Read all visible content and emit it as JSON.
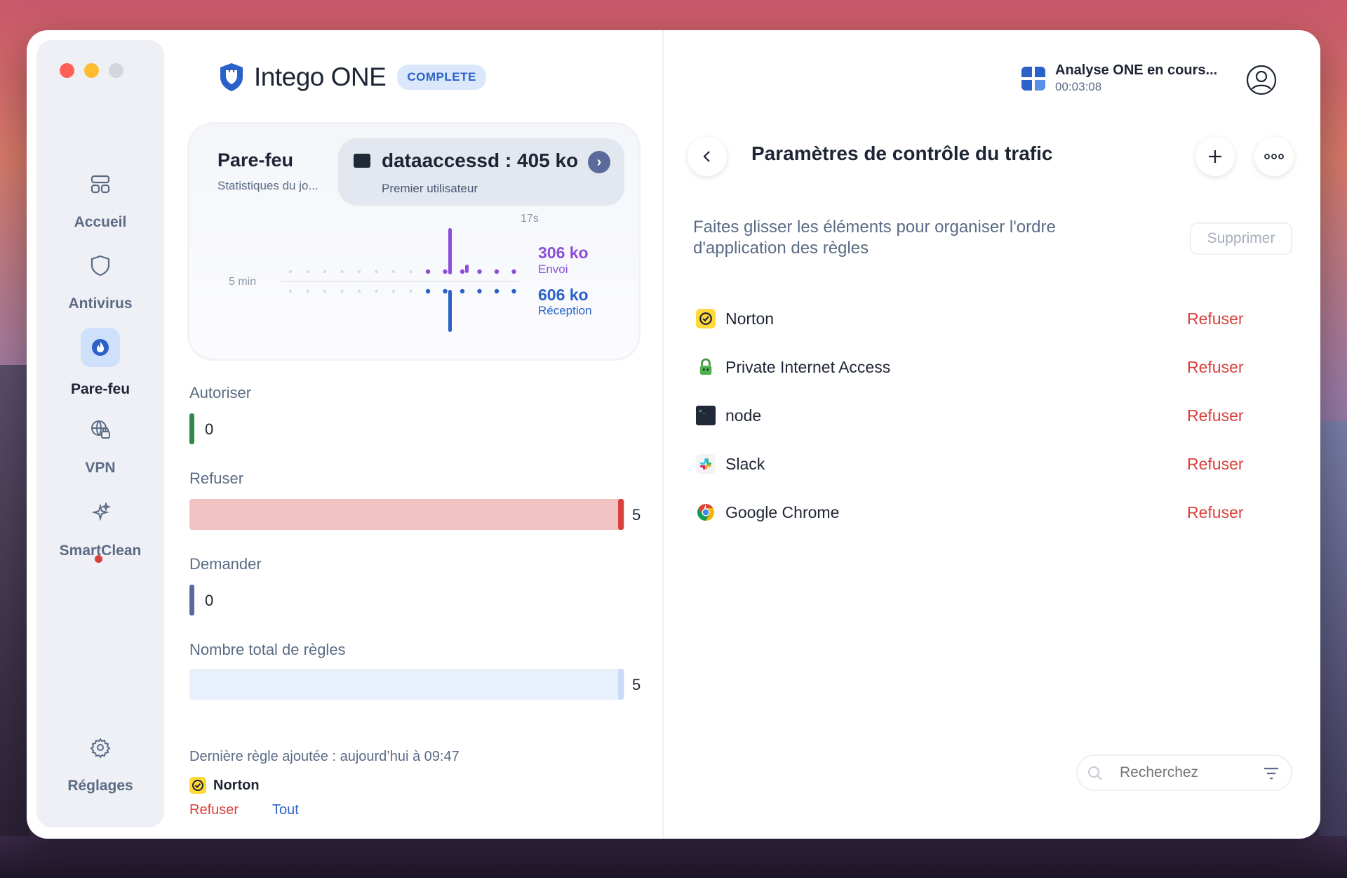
{
  "app": {
    "name": "Intego ONE",
    "badge": "COMPLETE"
  },
  "sidebar": {
    "items": [
      {
        "label": "Accueil",
        "icon": "home-grid-icon"
      },
      {
        "label": "Antivirus",
        "icon": "antivirus-shield-icon"
      },
      {
        "label": "Pare-feu",
        "icon": "firewall-flame-icon",
        "active": true
      },
      {
        "label": "VPN",
        "icon": "vpn-globe-icon"
      },
      {
        "label": "SmartClean",
        "icon": "smartclean-sparkle-icon",
        "notification": true
      },
      {
        "label": "Réglages",
        "icon": "gear-icon"
      }
    ]
  },
  "firewall_card": {
    "title": "Pare-feu",
    "subtitle": "Statistiques du jo...",
    "process": {
      "name": "dataaccessd : 405 ko",
      "sub": "Premier utilisateur"
    },
    "time_top": "17s",
    "time_left": "5 min",
    "sent": {
      "value": "306 ko",
      "label": "Envoi"
    },
    "received": {
      "value": "606 ko",
      "label": "Réception"
    }
  },
  "stats": {
    "allow": {
      "label": "Autoriser",
      "value": "0",
      "color": "#2f8a4a"
    },
    "deny": {
      "label": "Refuser",
      "value": "5",
      "color": "#d9413d"
    },
    "ask": {
      "label": "Demander",
      "value": "0",
      "color": "#5a6a9a"
    },
    "total": {
      "label": "Nombre total de règles",
      "value": "5",
      "color": "#b8cdf2"
    }
  },
  "last_rule": {
    "text": "Dernière règle ajoutée : aujourd’hui à 09:47",
    "app": "Norton",
    "action": "Refuser",
    "scope": "Tout"
  },
  "scan": {
    "title": "Analyse ONE en cours...",
    "time": "00:03:08"
  },
  "panel": {
    "title": "Paramètres de contrôle du trafic",
    "hint": "Faites glisser les éléments pour organiser l'ordre d'application des règles",
    "delete_label": "Supprimer",
    "rules": [
      {
        "name": "Norton",
        "action": "Refuser",
        "icon": "norton-icon"
      },
      {
        "name": "Private Internet Access",
        "action": "Refuser",
        "icon": "pia-lock-icon"
      },
      {
        "name": "node",
        "action": "Refuser",
        "icon": "terminal-icon"
      },
      {
        "name": "Slack",
        "action": "Refuser",
        "icon": "slack-icon"
      },
      {
        "name": "Google Chrome",
        "action": "Refuser",
        "icon": "chrome-icon"
      }
    ],
    "search_placeholder": "Recherchez"
  }
}
